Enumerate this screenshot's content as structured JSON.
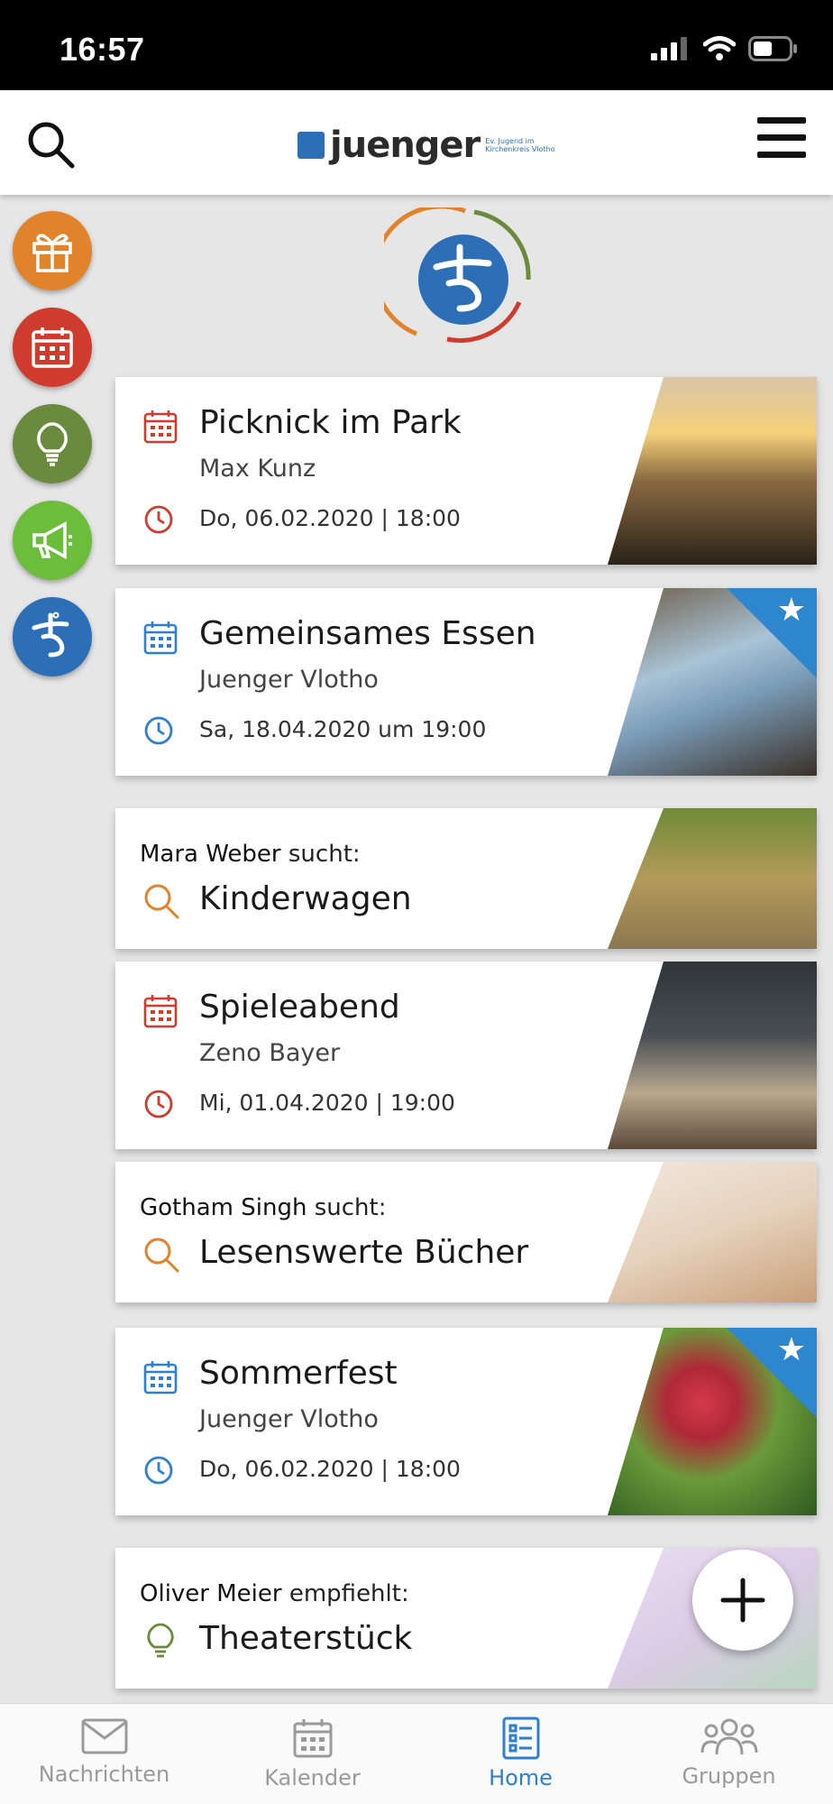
{
  "status_bar": {
    "time": "16:57"
  },
  "header": {
    "logo_text": "juenger",
    "logo_sub": "Ev. Jugend im Kirchenkreis Vlotho"
  },
  "side_rail": [
    {
      "icon": "gift-icon",
      "color": "#e0832a"
    },
    {
      "icon": "calendar-icon",
      "color": "#cf3b2d"
    },
    {
      "icon": "lightbulb-icon",
      "color": "#6a8a3d"
    },
    {
      "icon": "megaphone-icon",
      "color": "#6cbd3c"
    },
    {
      "icon": "juenger-logo-icon",
      "color": "#2d6fb6"
    }
  ],
  "cards": [
    {
      "type": "event",
      "title": "Picknick im Park",
      "organizer": "Max Kunz",
      "datetime": "Do, 06.02.2020 | 18:00",
      "accent": "#cf3b2d",
      "starred": false
    },
    {
      "type": "event",
      "title": "Gemeinsames Essen",
      "organizer": "Juenger Vlotho",
      "datetime": "Sa, 18.04.2020 um 19:00",
      "accent": "#2e7fd0",
      "starred": true
    },
    {
      "type": "search",
      "person": "Mara Weber",
      "verb": "sucht:",
      "title": "Kinderwagen",
      "accent": "#e0832a"
    },
    {
      "type": "event",
      "title": "Spieleabend",
      "organizer": "Zeno Bayer",
      "datetime": "Mi, 01.04.2020 | 19:00",
      "accent": "#cf3b2d",
      "starred": false
    },
    {
      "type": "search",
      "person": "Gotham Singh",
      "verb": "sucht:",
      "title": "Lesenswerte Bücher",
      "accent": "#e0832a"
    },
    {
      "type": "event",
      "title": "Sommerfest",
      "organizer": "Juenger Vlotho",
      "datetime": "Do, 06.02.2020 | 18:00",
      "accent": "#2e7fd0",
      "starred": true
    },
    {
      "type": "recommend",
      "person": "Oliver Meier",
      "verb": "empfiehlt:",
      "title": "Theaterstück",
      "accent": "#6a8a3d"
    }
  ],
  "tabs": [
    {
      "label": "Nachrichten",
      "icon": "envelope-icon",
      "active": false
    },
    {
      "label": "Kalender",
      "icon": "calendar-icon",
      "active": false
    },
    {
      "label": "Home",
      "icon": "list-icon",
      "active": true
    },
    {
      "label": "Gruppen",
      "icon": "group-icon",
      "active": false
    }
  ]
}
